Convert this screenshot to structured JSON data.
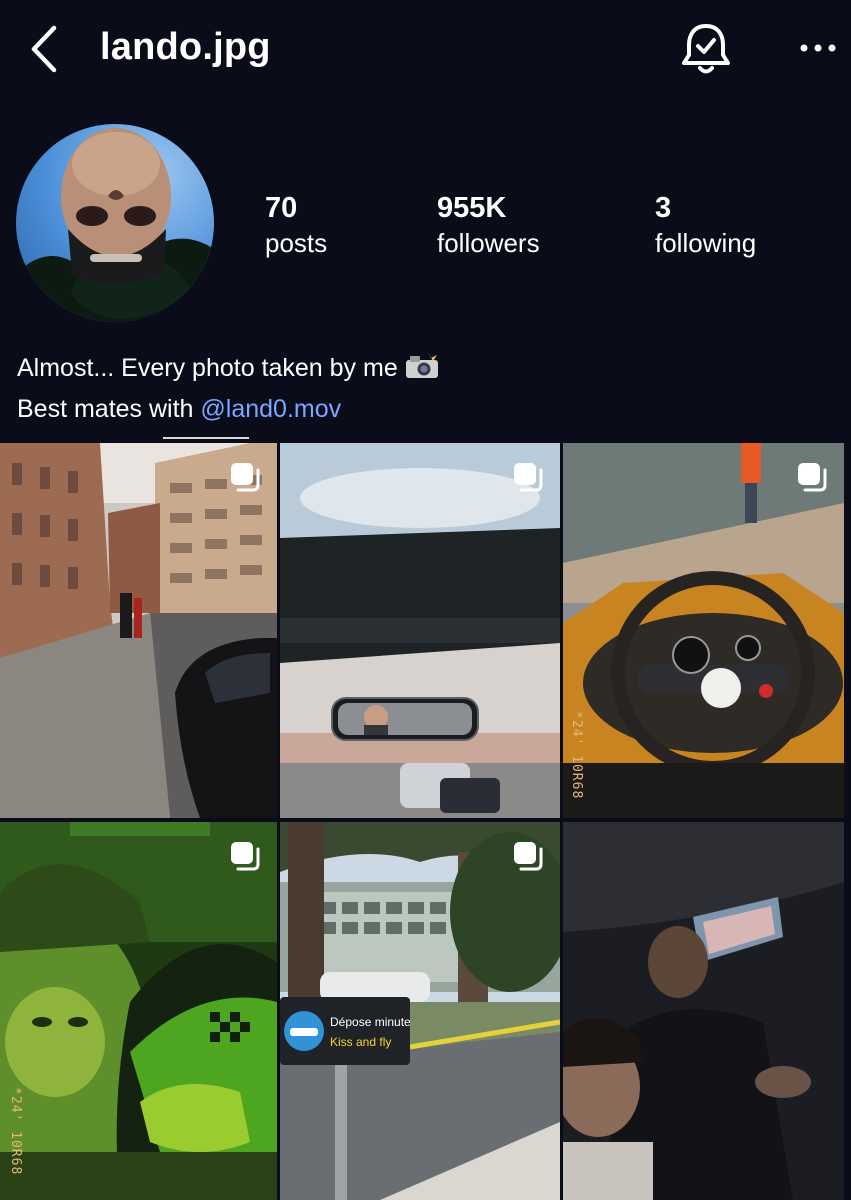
{
  "header": {
    "username": "lando.jpg",
    "back_icon": "chevron-left-icon",
    "bell_icon": "bell-check-icon",
    "more_icon": "more-horizontal-icon"
  },
  "profile": {
    "stats": [
      {
        "value": "70",
        "label": "posts"
      },
      {
        "value": "955K",
        "label": "followers"
      },
      {
        "value": "3",
        "label": "following"
      }
    ],
    "bio": {
      "line1": "Almost... Every photo taken by me",
      "line2_prefix": "Best mates with ",
      "mention": "@land0.mov"
    }
  },
  "grid": {
    "posts": [
      {
        "scene": "london street with parked car",
        "multi": true
      },
      {
        "scene": "car interior rear-view mirror selfie",
        "multi": true
      },
      {
        "scene": "race car cockpit steering wheel",
        "multi": true,
        "stamp": "*24' 10R68"
      },
      {
        "scene": "selfie with racing helmet green light",
        "multi": true,
        "stamp": "*24' 10R68"
      },
      {
        "scene": "drop off sign street",
        "multi": true,
        "sign_title": "Dépose minute",
        "sign_sub": "Kiss and fly"
      },
      {
        "scene": "dark car interior selfie",
        "multi": false
      }
    ]
  },
  "colors": {
    "background": "#0b0c1a",
    "mention": "#7aa7ff",
    "text": "#ffffff"
  }
}
